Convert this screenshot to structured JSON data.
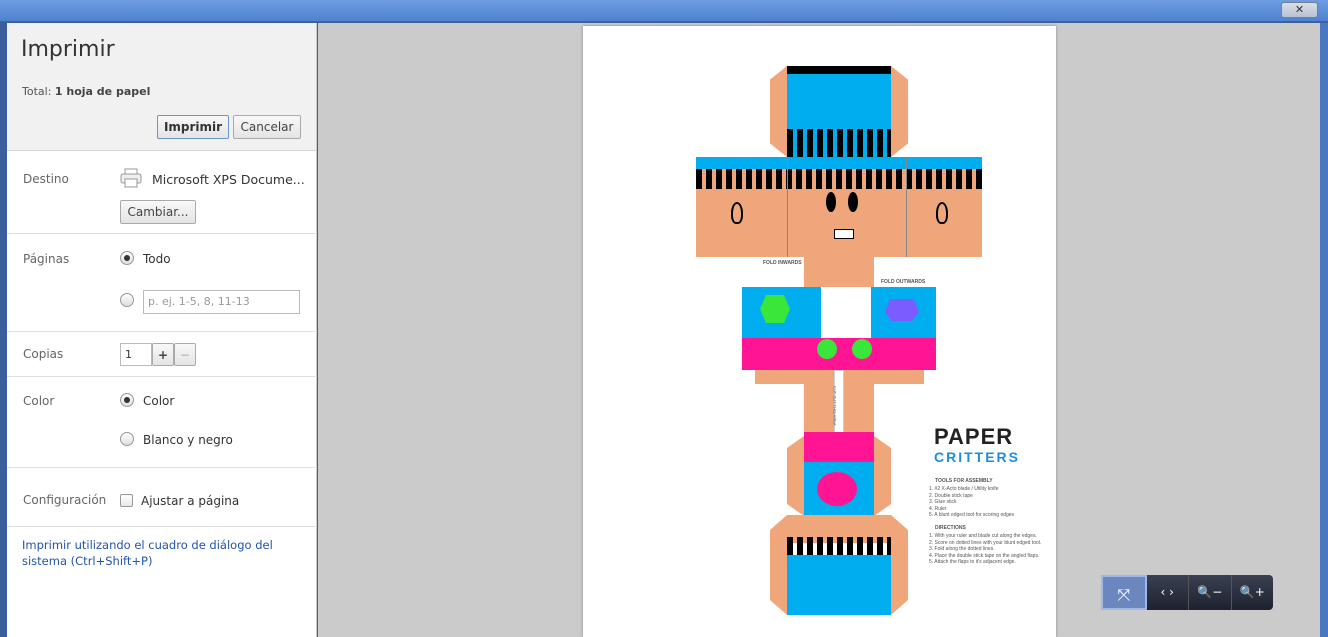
{
  "window": {
    "close_label": "✕"
  },
  "header": {
    "title": "Imprimir",
    "total_prefix": "Total:",
    "total_value": "1 hoja de papel",
    "print_label": "Imprimir",
    "cancel_label": "Cancelar"
  },
  "destination": {
    "label": "Destino",
    "printer": "Microsoft XPS Docume...",
    "change_label": "Cambiar..."
  },
  "pages": {
    "label": "Páginas",
    "all_label": "Todo",
    "range_placeholder": "p. ej. 1-5, 8, 11-13"
  },
  "copies": {
    "label": "Copias",
    "value": "1",
    "plus": "+",
    "minus": "−"
  },
  "color": {
    "label": "Color",
    "color_label": "Color",
    "bw_label": "Blanco y negro"
  },
  "config": {
    "label": "Configuración",
    "fit_label": "Ajustar a página"
  },
  "system_dialog_link": "Imprimir utilizando el cuadro de diálogo del sistema (Ctrl+Shift+P)",
  "preview": {
    "fold_inwards": "FOLD INWARDS",
    "fold_outwards": "FOLD OUTWARDS",
    "cut": "CUT OUT THIS AREA",
    "logo_top": "PAPER",
    "logo_bottom": "CRITTERS",
    "tools_title": "TOOLS FOR ASSEMBLY",
    "tools": [
      "1. #2 X-Acto blade / Utility knife",
      "2. Double stick tape",
      "3. Glue stick",
      "4. Ruler",
      "5. A blunt edged tool for scoring edges"
    ],
    "directions_title": "DIRECTIONS",
    "directions": [
      "1. With your ruler and blade cut along the edges.",
      "2. Score on dotted lines with your blunt edged tool.",
      "3. Fold along the dotted lines.",
      "4. Place the double stick tape on the angled flaps.",
      "5. Attach the flaps to it's adjacent edge."
    ]
  },
  "zoom_controls": {
    "fit": "⤧",
    "width": "‹ ›",
    "zoom_out": "🔍−",
    "zoom_in": "🔍+"
  }
}
